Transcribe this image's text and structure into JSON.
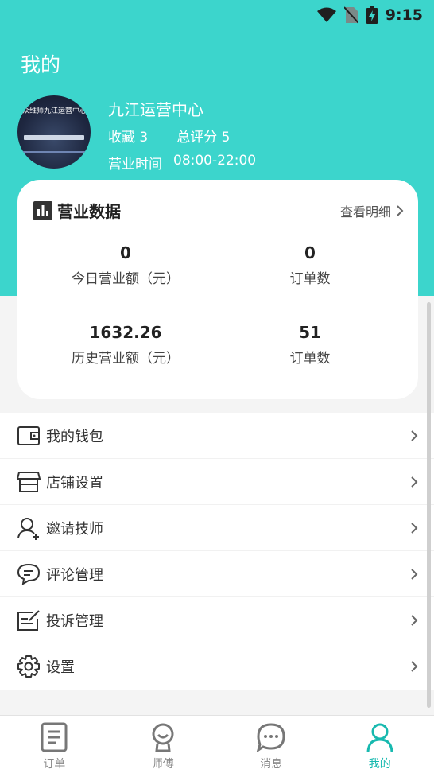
{
  "status_bar": {
    "time": "9:15",
    "icons": [
      "wifi-icon",
      "no-sim-icon",
      "battery-charging-icon"
    ]
  },
  "page": {
    "title": "我的"
  },
  "profile": {
    "store_name": "九江运营中心",
    "favorites": "收藏 3",
    "total_score": "总评分 5",
    "hours_label": "营业时间",
    "hours_value": "08:00-22:00",
    "avatar_text": "众维师九江运营中心"
  },
  "business_card": {
    "title": "营业数据",
    "detail_link": "查看明细",
    "metrics": [
      {
        "value": "0",
        "label": "今日营业额（元）"
      },
      {
        "value": "0",
        "label": "订单数"
      },
      {
        "value": "1632.26",
        "label": "历史营业额（元）"
      },
      {
        "value": "51",
        "label": "订单数"
      }
    ]
  },
  "menu": [
    {
      "label": "我的钱包",
      "icon": "wallet-icon"
    },
    {
      "label": "店铺设置",
      "icon": "store-icon"
    },
    {
      "label": "邀请技师",
      "icon": "invite-user-icon"
    },
    {
      "label": "评论管理",
      "icon": "comment-icon"
    },
    {
      "label": "投诉管理",
      "icon": "complaint-icon"
    },
    {
      "label": "设置",
      "icon": "gear-icon"
    }
  ],
  "tabs": [
    {
      "label": "订单",
      "icon": "order-icon"
    },
    {
      "label": "师傅",
      "icon": "technician-icon"
    },
    {
      "label": "消息",
      "icon": "message-icon"
    },
    {
      "label": "我的",
      "icon": "profile-icon",
      "active": true
    }
  ],
  "colors": {
    "brand": "#3cd5cc",
    "active_tab": "#17b9af"
  }
}
